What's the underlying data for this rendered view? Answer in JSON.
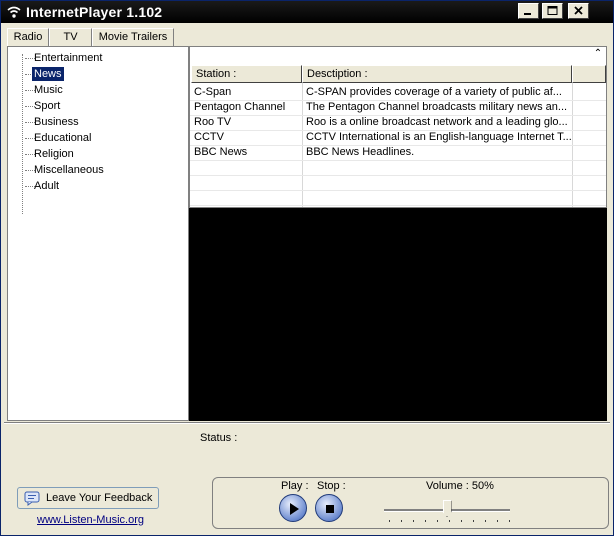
{
  "window": {
    "title": "InternetPlayer 1.102"
  },
  "tabs": [
    {
      "label": "Radio"
    },
    {
      "label": "TV"
    },
    {
      "label": "Movie Trailers"
    }
  ],
  "categories": [
    {
      "label": "Entertainment"
    },
    {
      "label": "News"
    },
    {
      "label": "Music"
    },
    {
      "label": "Sport"
    },
    {
      "label": "Business"
    },
    {
      "label": "Educational"
    },
    {
      "label": "Religion"
    },
    {
      "label": "Miscellaneous"
    },
    {
      "label": "Adult"
    }
  ],
  "selected_category": "News",
  "grid": {
    "columns": [
      "Station :",
      "Desctiption :"
    ],
    "rows": [
      {
        "station": "C-Span",
        "description": "C-SPAN provides coverage of a variety of public af..."
      },
      {
        "station": "Pentagon Channel",
        "description": "The Pentagon Channel broadcasts military news an..."
      },
      {
        "station": "Roo TV",
        "description": "Roo is a online broadcast network and a leading glo..."
      },
      {
        "station": "CCTV",
        "description": "CCTV International is an English-language Internet T..."
      },
      {
        "station": "BBC News",
        "description": "BBC News Headlines."
      }
    ]
  },
  "status": {
    "label": "Status :"
  },
  "feedback": {
    "label": "Leave Your Feedback",
    "link": "www.Listen-Music.org"
  },
  "controls": {
    "play_label": "Play :",
    "stop_label": "Stop :",
    "volume_label": "Volume : 50%",
    "volume": 0.5
  }
}
